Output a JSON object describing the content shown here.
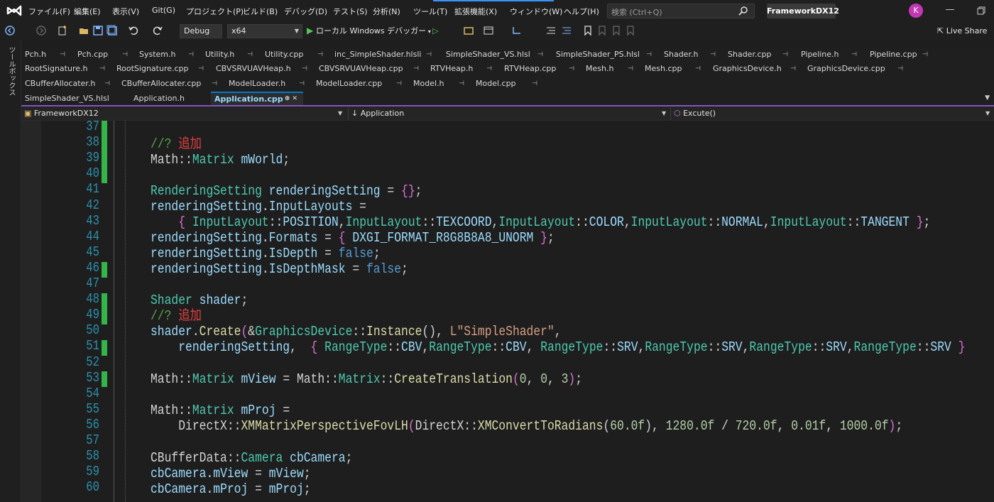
{
  "menu": {
    "items": [
      "ファイル(F)",
      "編集(E)",
      "表示(V)",
      "Git(G)",
      "プロジェクト(P)",
      "ビルド(B)",
      "デバッグ(D)",
      "テスト(S)",
      "分析(N)",
      "ツール(T)",
      "拡張機能(X)",
      "ウィンドウ(W)",
      "ヘルプ(H)"
    ],
    "search_placeholder": "検索 (Ctrl+Q)",
    "solution_name": "FrameworkDX12",
    "avatar_initial": "K"
  },
  "toolbar": {
    "configuration": "Debug",
    "platform": "x64",
    "run_label": "ローカル Windows デバッガー",
    "live_share": "Live Share"
  },
  "toolbox": {
    "label": "ツールボックス"
  },
  "tabs": {
    "row1": [
      "Pch.h",
      "Pch.cpp",
      "System.h",
      "Utility.h",
      "Utility.cpp",
      "inc_SimpleShader.hlsli",
      "SimpleShader_VS.hlsl",
      "SimpleShader_PS.hlsl",
      "Shader.h",
      "Shader.cpp",
      "Pipeline.h",
      "Pipeline.cpp"
    ],
    "row2": [
      "RootSignature.h",
      "RootSignature.cpp",
      "CBVSRVUAVHeap.h",
      "CBVSRVUAVHeap.cpp",
      "RTVHeap.h",
      "RTVHeap.cpp",
      "Mesh.h",
      "Mesh.cpp",
      "GraphicsDevice.h",
      "GraphicsDevice.cpp"
    ],
    "row3": [
      "CBufferAllocater.h",
      "CBufferAllocater.cpp",
      "ModelLoader.h",
      "ModelLoader.cpp",
      "Model.h",
      "Model.cpp"
    ],
    "row4": [
      "SimpleShader_VS.hlsl",
      "Application.h",
      "Application.cpp"
    ],
    "pin_glyph": "🖈",
    "close_glyph": "✕"
  },
  "navbar": {
    "project": "FrameworkDX12",
    "scope": "Application",
    "member": "Excute()"
  },
  "editor": {
    "line_numbers": [
      "37",
      "38",
      "39",
      "40",
      "41",
      "42",
      "43",
      "44",
      "45",
      "46",
      "47",
      "48",
      "49",
      "50",
      "51",
      "52",
      "53",
      "54",
      "55",
      "56",
      "57",
      "58",
      "59",
      "60"
    ],
    "comment_prefix": "//? ",
    "comment_text": "追加"
  }
}
